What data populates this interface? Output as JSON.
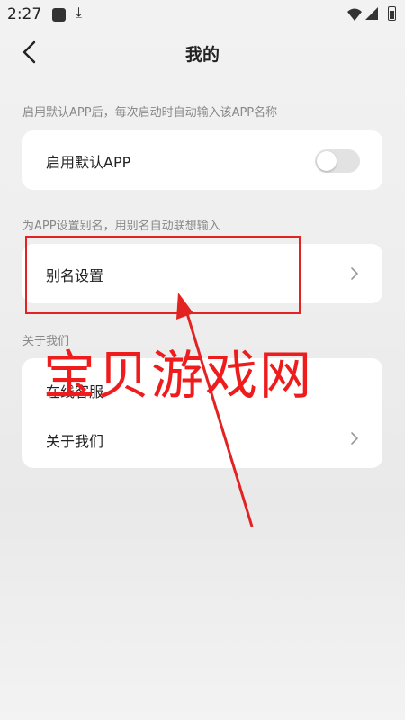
{
  "status_bar": {
    "time": "2:27"
  },
  "header": {
    "title": "我的"
  },
  "default_app_section": {
    "hint": "启用默认APP后，每次启动时自动输入该APP名称",
    "toggle_label": "启用默认APP",
    "toggle_on": false
  },
  "alias_section": {
    "hint": "为APP设置别名，用别名自动联想输入",
    "alias_label": "别名设置"
  },
  "about_section": {
    "hint": "关于我们",
    "items": [
      {
        "label": "在线客服"
      },
      {
        "label": "关于我们"
      }
    ]
  },
  "watermark": {
    "text": "宝贝游戏网"
  },
  "colors": {
    "annotation": "#e32222",
    "toggle_off": "#e2e2e2"
  }
}
